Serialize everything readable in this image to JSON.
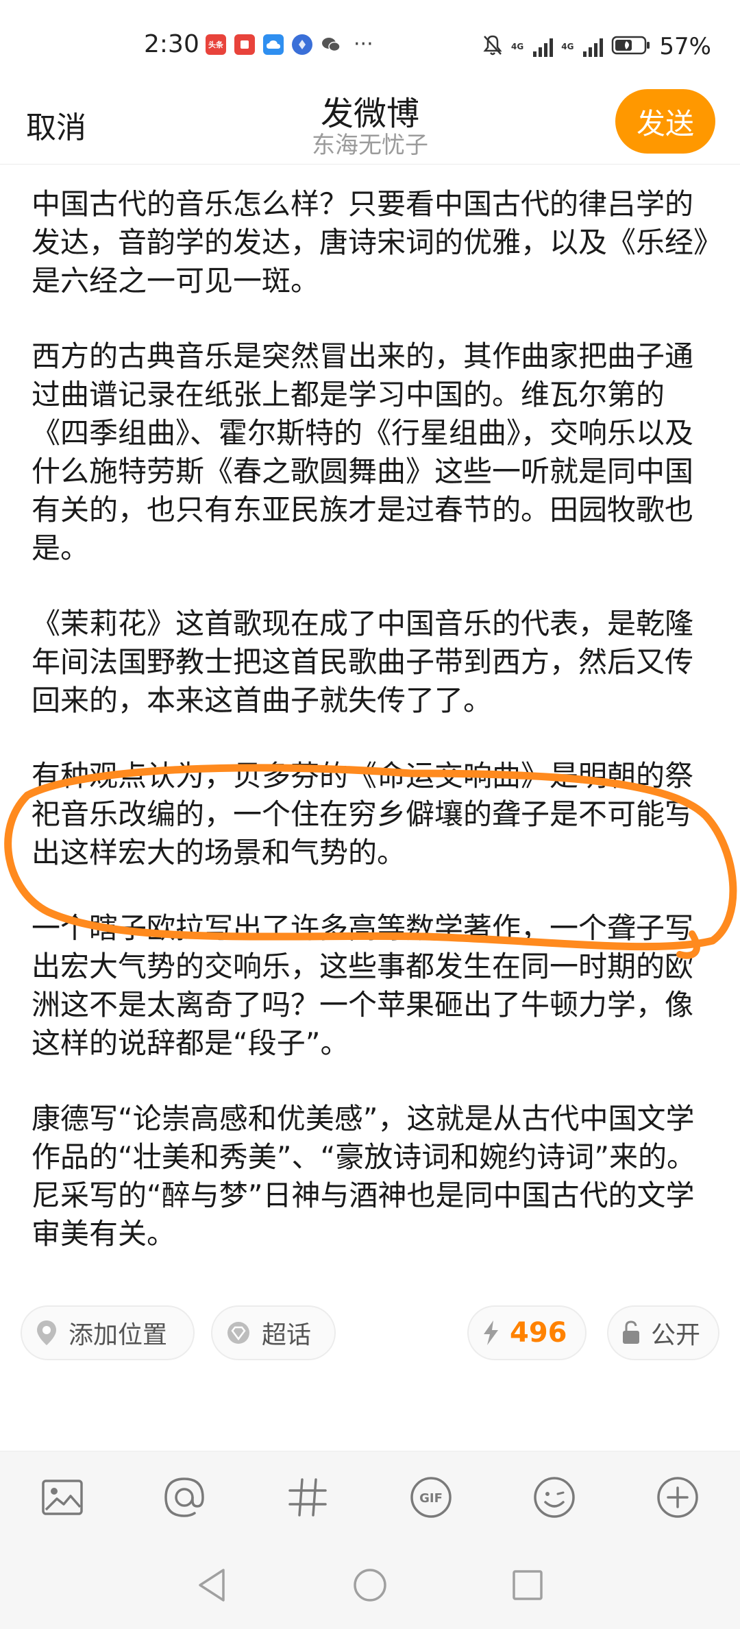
{
  "status_bar": {
    "time": "2:30",
    "app_badges": [
      {
        "name": "toutiao-app-icon",
        "label": "头条",
        "color": "#e8433b"
      },
      {
        "name": "reader-app-icon",
        "label": "",
        "color": "#e8433b"
      },
      {
        "name": "cloud-app-icon",
        "label": "",
        "color": "#2f8ff0"
      },
      {
        "name": "browser-app-icon",
        "label": "",
        "color": "#3a6fd8"
      },
      {
        "name": "wechat-app-icon",
        "label": "",
        "color": "#555555"
      }
    ],
    "more": "···",
    "network_type_1": "4G",
    "network_type_2": "4G",
    "battery": "57%"
  },
  "header": {
    "cancel_label": "取消",
    "title": "发微博",
    "subtitle": "东海无忧子",
    "send_label": "发送",
    "send_color": "#ff9800"
  },
  "post": {
    "paragraphs": [
      "中国古代的音乐怎么样？只要看中国古代的律吕学的发达，音韵学的发达，唐诗宋词的优雅，以及《乐经》是六经之一可见一斑。",
      "西方的古典音乐是突然冒出来的，其作曲家把曲子通过曲谱记录在纸张上都是学习中国的。维瓦尔第的《四季组曲》、霍尔斯特的《行星组曲》，交响乐以及什么施特劳斯《春之歌圆舞曲》这些一听就是同中国有关的，也只有东亚民族才是过春节的。田园牧歌也是。",
      "《茉莉花》这首歌现在成了中国音乐的代表，是乾隆年间法国野教士把这首民歌曲子带到西方，然后又传回来的，本来这首曲子就失传了了。",
      "有种观点认为，贝多芬的《命运交响曲》是明朝的祭祀音乐改编的，一个住在穷乡僻壤的聋子是不可能写出这样宏大的场景和气势的。",
      "一个瞎子欧拉写出了许多高等数学著作，一个聋子写出宏大气势的交响乐，这些事都发生在同一时期的欧洲这不是太离奇了吗？一个苹果砸出了牛顿力学，像这样的说辞都是“段子”。",
      "康德写“论崇高感和优美感”，这就是从古代中国文学作品的“壮美和秀美”、“豪放诗词和婉约诗词”来的。尼采写的“醉与梦”日神与酒神也是同中国古代的文学审美有关。"
    ],
    "highlight_color": "#ff8a1e"
  },
  "chips": {
    "location_label": "添加位置",
    "topic_label": "超话",
    "count": "496",
    "count_color": "#ff8200",
    "visibility_label": "公开"
  },
  "toolbar": {
    "items": [
      "image-icon",
      "mention-icon",
      "hashtag-icon",
      "gif-icon",
      "emoji-icon",
      "add-icon"
    ]
  },
  "navbar": {
    "items": [
      "back-icon",
      "home-icon",
      "recent-apps-icon"
    ]
  }
}
